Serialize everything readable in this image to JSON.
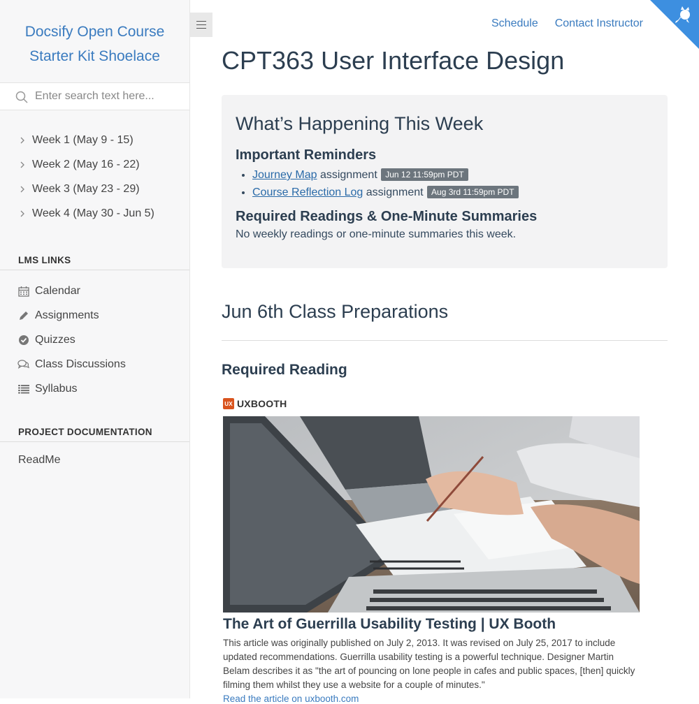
{
  "sidebar": {
    "app_name_line1": "Docsify Open Course",
    "app_name_line2": "Starter Kit Shoelace",
    "search_placeholder": "Enter search text here...",
    "weeks": [
      "Week 1 (May 9 - 15)",
      "Week 2 (May 16 - 22)",
      "Week 3 (May 23 - 29)",
      "Week 4 (May 30 - Jun 5)"
    ],
    "lms_title": "LMS LINKS",
    "lms_links": [
      {
        "label": "Calendar",
        "icon": "calendar-icon"
      },
      {
        "label": "Assignments",
        "icon": "pencil-icon"
      },
      {
        "label": "Quizzes",
        "icon": "check-circle-icon"
      },
      {
        "label": "Class Discussions",
        "icon": "comments-icon"
      },
      {
        "label": "Syllabus",
        "icon": "list-icon"
      }
    ],
    "project_title": "PROJECT DOCUMENTATION",
    "project_links": [
      "ReadMe"
    ]
  },
  "nav": {
    "schedule": "Schedule",
    "contact": "Contact Instructor"
  },
  "main": {
    "title": "CPT363 User Interface Design",
    "callout": {
      "heading": "What’s Happening This Week",
      "reminders_heading": "Important Reminders",
      "reminders": [
        {
          "link": "Journey Map",
          "text": " assignment ",
          "badge": "Jun 12 11:59pm PDT"
        },
        {
          "link": "Course Reflection Log",
          "text": " assignment ",
          "badge": "Aug 3rd 11:59pm PDT"
        }
      ],
      "readings_heading": "Required Readings & One-Minute Summaries",
      "readings_text": "No weekly readings or one-minute summaries this week."
    },
    "section_heading": "Jun 6th Class Preparations",
    "sub_heading": "Required Reading",
    "card": {
      "favicon_text": "UX",
      "source": "UXBOOTH",
      "title": "The Art of Guerrilla Usability Testing | UX Booth",
      "description": "This article was originally published on July 2, 2013. It was revised on July 25, 2017 to include updated recommendations. Guerrilla usability testing is a powerful technique. Designer Martin Belam describes it as \"the art of pouncing on lone people in cafes and public spaces, [then] quickly filming them whilst they use a website for a couple of minutes.\"",
      "link": "Read the article on uxbooth.com"
    }
  },
  "colors": {
    "accent": "#3a7bbf",
    "sidebar_bg": "#f7f7f8",
    "badge_bg": "#6c757d",
    "corner": "#3d8fe0"
  }
}
